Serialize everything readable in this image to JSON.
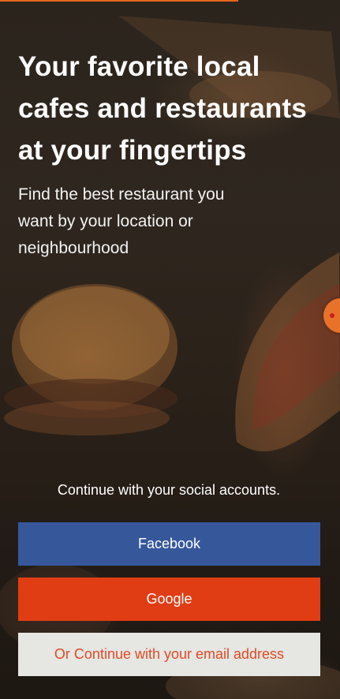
{
  "onboarding": {
    "headline": "Your favorite local cafes and restaurants at your fingertips",
    "subtitle": "Find the best restaurant you want by your location or neighbourhood",
    "social_caption": "Continue with your social accounts.",
    "progress_fraction": 0.7
  },
  "auth_buttons": {
    "facebook_label": "Facebook",
    "google_label": "Google",
    "email_label": "Or Continue with your email address"
  },
  "colors": {
    "accent": "#e8661e",
    "facebook": "#37579b",
    "google": "#e03d15",
    "email_button_bg": "#e6e6e3",
    "email_button_text": "#e14a24"
  },
  "icons": {
    "side_handle": "orange-circle-handle-icon"
  }
}
